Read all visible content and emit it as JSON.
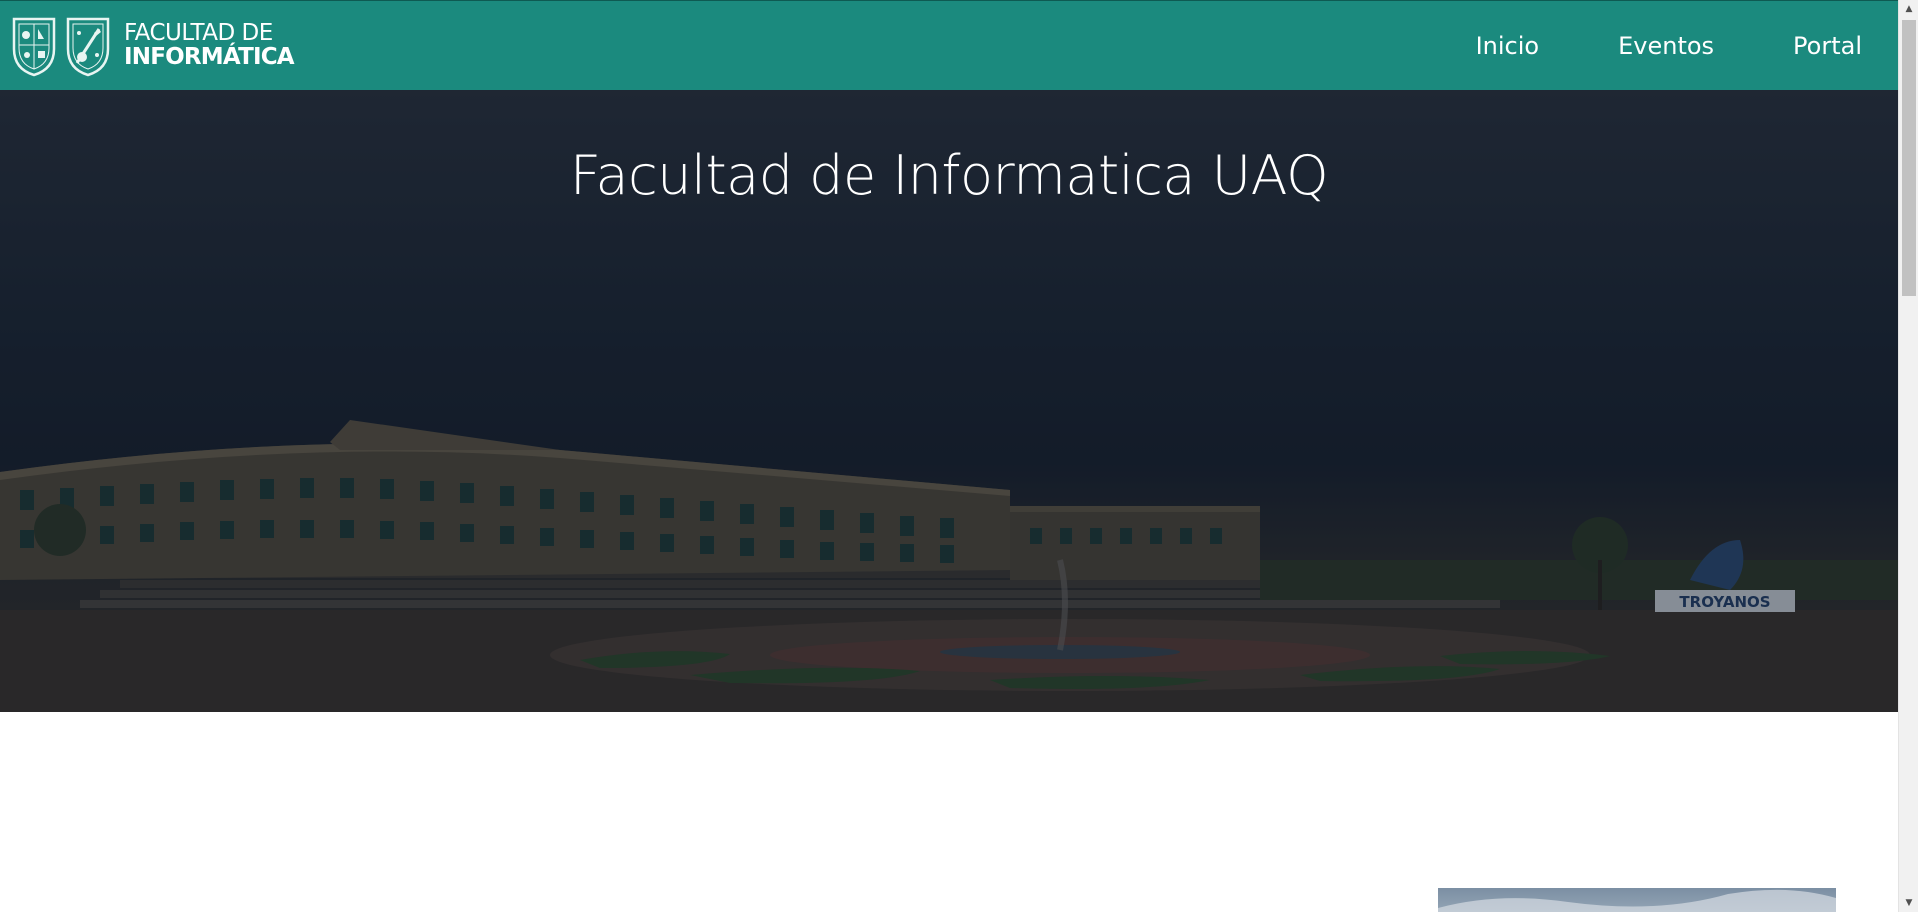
{
  "navbar": {
    "brand": {
      "line1": "FACULTAD DE",
      "line2": "INFORMÁTICA",
      "shield_left_icon": "university-shield-icon",
      "shield_right_icon": "faculty-shield-icon"
    },
    "links": [
      {
        "label": "Inicio"
      },
      {
        "label": "Eventos"
      },
      {
        "label": "Portal"
      }
    ]
  },
  "hero": {
    "title": "Facultad de Informatica UAQ",
    "sign_text": "TROYANOS"
  },
  "colors": {
    "navbar": "#1b8a7e",
    "hero_overlay": "#1d2736",
    "text": "#ffffff"
  },
  "scrollbar": {
    "up_icon": "scroll-up-arrow-icon",
    "down_icon": "scroll-down-arrow-icon"
  }
}
